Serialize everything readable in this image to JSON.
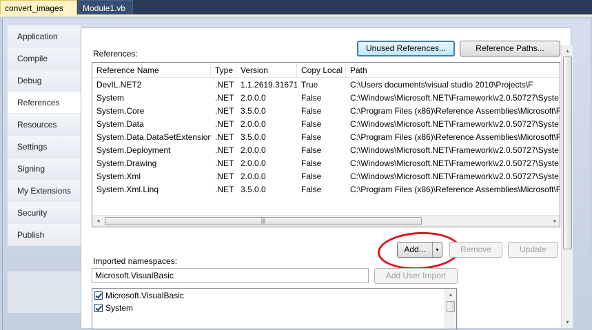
{
  "tabs": [
    {
      "label": "convert_images",
      "active": true
    },
    {
      "label": "Module1.vb",
      "active": false
    }
  ],
  "nav": {
    "items": [
      "Application",
      "Compile",
      "Debug",
      "References",
      "Resources",
      "Settings",
      "Signing",
      "My Extensions",
      "Security",
      "Publish"
    ],
    "selected": "References"
  },
  "references": {
    "label": "References:",
    "unused_button": "Unused References...",
    "paths_button": "Reference Paths...",
    "columns": [
      "Reference Name",
      "Type",
      "Version",
      "Copy Local",
      "Path"
    ],
    "rows": [
      [
        "DevIL.NET2",
        ".NET",
        "1.1.2619.31671",
        "True",
        "C:\\Users              documents\\visual studio 2010\\Projects\\F"
      ],
      [
        "System",
        ".NET",
        "2.0.0.0",
        "False",
        "C:\\Windows\\Microsoft.NET\\Framework\\v2.0.50727\\Syste"
      ],
      [
        "System.Core",
        ".NET",
        "3.5.0.0",
        "False",
        "C:\\Program Files (x86)\\Reference Assemblies\\Microsoft\\F"
      ],
      [
        "System.Data",
        ".NET",
        "2.0.0.0",
        "False",
        "C:\\Windows\\Microsoft.NET\\Framework\\v2.0.50727\\Syste"
      ],
      [
        "System.Data.DataSetExtensions",
        ".NET",
        "3.5.0.0",
        "False",
        "C:\\Program Files (x86)\\Reference Assemblies\\Microsoft\\F"
      ],
      [
        "System.Deployment",
        ".NET",
        "2.0.0.0",
        "False",
        "C:\\Windows\\Microsoft.NET\\Framework\\v2.0.50727\\Syste"
      ],
      [
        "System.Drawing",
        ".NET",
        "2.0.0.0",
        "False",
        "C:\\Windows\\Microsoft.NET\\Framework\\v2.0.50727\\Syste"
      ],
      [
        "System.Xml",
        ".NET",
        "2.0.0.0",
        "False",
        "C:\\Windows\\Microsoft.NET\\Framework\\v2.0.50727\\Syste"
      ],
      [
        "System.Xml.Linq",
        ".NET",
        "3.5.0.0",
        "False",
        "C:\\Program Files (x86)\\Reference Assemblies\\Microsoft\\F"
      ]
    ],
    "add_button": "Add...",
    "remove_button": "Remove",
    "update_button": "Update"
  },
  "imports": {
    "label": "Imported namespaces:",
    "textbox_value": "Microsoft.VisualBasic",
    "add_user_import_button": "Add User Import",
    "items": [
      {
        "label": "Microsoft.VisualBasic",
        "checked": true
      },
      {
        "label": "System",
        "checked": true
      }
    ]
  },
  "icons": {
    "left_arrow": "◂",
    "right_arrow": "▸",
    "up_arrow": "▴",
    "down_arrow": "▾",
    "grip": "|||"
  },
  "colors": {
    "active_tab": "#fdf3c6",
    "highlight_circle": "#e0141a",
    "default_button_border": "#3c7fb1"
  }
}
